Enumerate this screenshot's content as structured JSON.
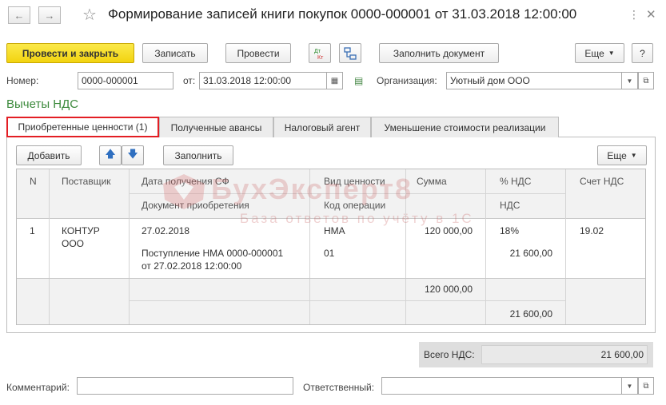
{
  "window": {
    "title": "Формирование записей книги покупок 0000-000001 от 31.03.2018 12:00:00"
  },
  "toolbar": {
    "post_and_close": "Провести и закрыть",
    "save": "Записать",
    "post": "Провести",
    "dtkt_icon": "Дт Кт",
    "fill_document": "Заполнить документ",
    "more": "Еще",
    "help": "?"
  },
  "header": {
    "number_label": "Номер:",
    "number_value": "0000-000001",
    "date_label": "от:",
    "date_value": "31.03.2018 12:00:00",
    "org_label": "Организация:",
    "org_value": "Уютный дом ООО"
  },
  "section_title": "Вычеты НДС",
  "tabs": [
    {
      "label": "Приобретенные ценности (1)",
      "active": true
    },
    {
      "label": "Полученные авансы",
      "active": false
    },
    {
      "label": "Налоговый агент",
      "active": false
    },
    {
      "label": "Уменьшение стоимости реализации",
      "active": false
    }
  ],
  "table_toolbar": {
    "add": "Добавить",
    "fill": "Заполнить",
    "more": "Еще"
  },
  "table": {
    "columns": {
      "n": "N",
      "supplier": "Поставщик",
      "sf_date": "Дата получения СФ",
      "purchase_doc": "Документ приобретения",
      "value_type": "Вид ценности",
      "operation_code": "Код операции",
      "amount": "Сумма",
      "vat_percent": "% НДС",
      "vat": "НДС",
      "vat_account": "Счет НДС"
    },
    "rows": [
      {
        "n": "1",
        "supplier_line1": "КОНТУР",
        "supplier_line2": "ООО",
        "sf_date": "27.02.2018",
        "purchase_doc_line1": "Поступление НМА 0000-000001",
        "purchase_doc_line2": "от 27.02.2018 12:00:00",
        "value_type": "НМА",
        "operation_code": "01",
        "amount": "120 000,00",
        "vat_percent": "18%",
        "vat": "21 600,00",
        "vat_account": "19.02"
      }
    ],
    "footer": {
      "amount_total": "120 000,00",
      "vat_total": "21 600,00"
    }
  },
  "totals": {
    "label": "Всего НДС:",
    "value": "21 600,00"
  },
  "bottom": {
    "comment_label": "Комментарий:",
    "comment_value": "",
    "responsible_label": "Ответственный:",
    "responsible_value": ""
  },
  "watermark": {
    "brand": "БухЭксперт8",
    "slogan": "База ответов по учёту в 1С"
  },
  "colors": {
    "primary_button": "#f2d30f",
    "section_title": "#3c8a3c",
    "active_tab_border": "#e31e24",
    "watermark": "#e0a0a0"
  }
}
